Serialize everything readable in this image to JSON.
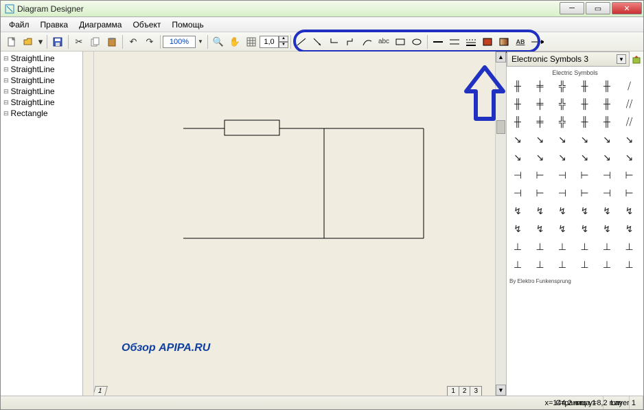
{
  "window": {
    "title": "Diagram Designer"
  },
  "menu": {
    "file": "Файл",
    "edit": "Правка",
    "diagram": "Диаграмма",
    "object": "Объект",
    "help": "Помощь"
  },
  "toolbar": {
    "zoom": "100%",
    "grid": "1,0"
  },
  "tree": {
    "items": [
      "StraightLine",
      "StraightLine",
      "StraightLine",
      "StraightLine",
      "StraightLine",
      "Rectangle"
    ]
  },
  "palette": {
    "title": "Electronic Symbols 3",
    "heading": "Electric Symbols",
    "credit": "By Elektro Funkensprung"
  },
  "status": {
    "page": "Страница 1",
    "layer": "Layer 1",
    "coords": "x=144,2 mm  y=8,2 mm"
  },
  "watermark": "Обзор APIPA.RU",
  "tabs": {
    "t1": "1",
    "t2": "1",
    "t3": "2",
    "t4": "3"
  }
}
